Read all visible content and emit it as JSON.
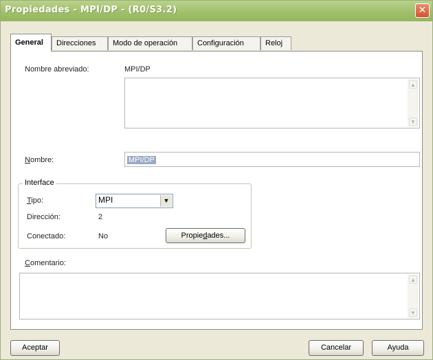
{
  "window": {
    "title": "Propiedades - MPI/DP - (R0/S3.2)",
    "close_glyph": "✕"
  },
  "tabs": [
    {
      "label": "General",
      "active": true
    },
    {
      "label": "Direcciones"
    },
    {
      "label": "Modo de operación"
    },
    {
      "label": "Configuración"
    },
    {
      "label": "Reloj"
    }
  ],
  "general": {
    "short_name_label": "Nombre abreviado:",
    "short_name_value": "MPI/DP",
    "name_label_mnemonic": "N",
    "name_label_rest": "ombre:",
    "name_value": "MPI/DP",
    "interface": {
      "legend": "Interface",
      "type_label_mnemonic": "T",
      "type_label_rest": "ipo:",
      "type_value": "MPI",
      "address_label": "Dirección:",
      "address_value": "2",
      "connected_label": "Conectado:",
      "connected_value": "No",
      "properties_btn_pre": "Propie",
      "properties_btn_mnemonic": "d",
      "properties_btn_post": "ades..."
    },
    "comment_label_mnemonic": "C",
    "comment_label_rest": "omentario:",
    "comment_value": ""
  },
  "footer": {
    "accept": "Aceptar",
    "cancel": "Cancelar",
    "help": "Ayuda"
  }
}
